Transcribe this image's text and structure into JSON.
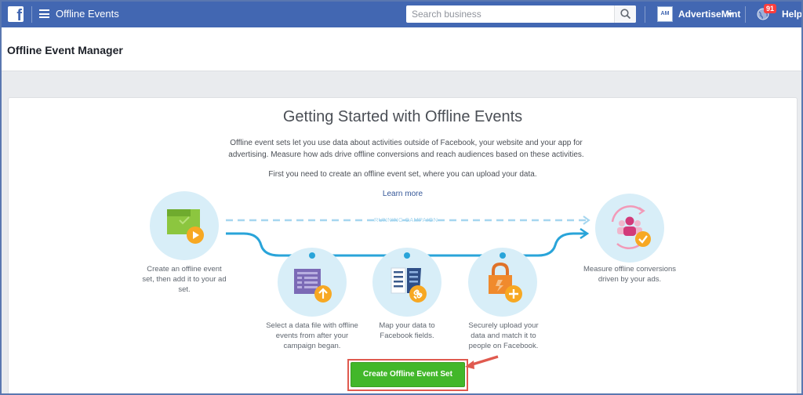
{
  "topbar": {
    "app_title": "Offline Events",
    "search_placeholder": "Search business",
    "account_initials": "AM",
    "account_name": "AdvertiseMint",
    "notification_count": "91",
    "help_label": "Help"
  },
  "page": {
    "title": "Offline Event Manager"
  },
  "card": {
    "heading": "Getting Started with Offline Events",
    "intro": "Offline event sets let you use data about activities outside of Facebook, your website and your app for advertising. Measure how ads drive offline conversions and reach audiences based on these activities.",
    "intro2": "First you need to create an offline event set, where you can upload your data.",
    "learn_more": "Learn more",
    "running_campaign": "RUNNING CAMPAIGN",
    "steps": [
      {
        "label": "Create an offline event set, then add it to your ad set.",
        "icon": "video-file-icon"
      },
      {
        "label": "Select a data file with offline events from after your campaign began.",
        "icon": "upload-file-icon"
      },
      {
        "label": "Map your data to Facebook fields.",
        "icon": "link-fields-icon"
      },
      {
        "label": "Securely upload your data and match it to people on Facebook.",
        "icon": "secure-lock-icon"
      },
      {
        "label": "Measure offline conversions driven by your ads.",
        "icon": "audience-check-icon"
      }
    ],
    "cta_label": "Create Offline Event Set"
  },
  "colors": {
    "topbar": "#4267b2",
    "accent_green": "#42b72a",
    "flow_line": "#29a4d9",
    "callout_red": "#e05a4f"
  }
}
